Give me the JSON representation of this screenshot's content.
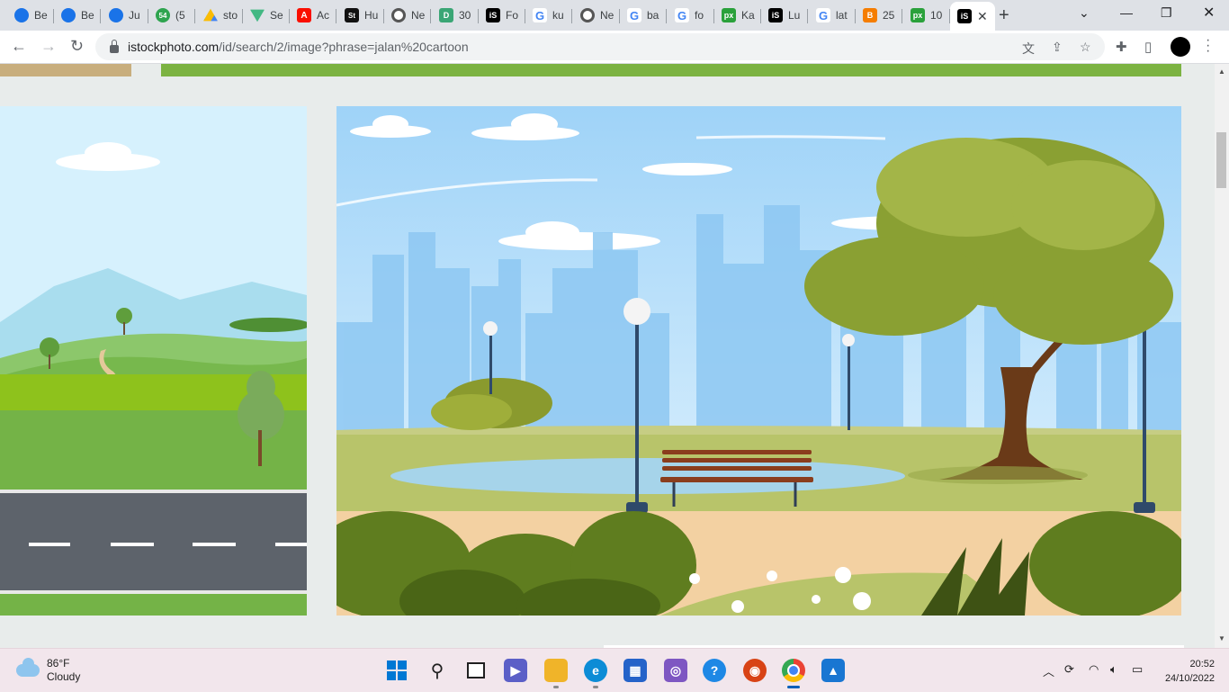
{
  "tabs": [
    {
      "label": "Be",
      "icon": "c"
    },
    {
      "label": "Be",
      "icon": "c"
    },
    {
      "label": "Ju",
      "icon": "c"
    },
    {
      "label": "(5",
      "icon": "n54",
      "icon_text": "54"
    },
    {
      "label": "sto",
      "icon": "drive"
    },
    {
      "label": "Se",
      "icon": "vue"
    },
    {
      "label": "Ac",
      "icon": "adobe",
      "icon_text": "A"
    },
    {
      "label": "Hu",
      "icon": "st",
      "icon_text": "St"
    },
    {
      "label": "Ne",
      "icon": "gh"
    },
    {
      "label": "30",
      "icon": "d",
      "icon_text": "D"
    },
    {
      "label": "Fo",
      "icon": "is",
      "icon_text": "iS"
    },
    {
      "label": "ku",
      "icon": "g",
      "icon_text": "G"
    },
    {
      "label": "Ne",
      "icon": "gh"
    },
    {
      "label": "ba",
      "icon": "g",
      "icon_text": "G"
    },
    {
      "label": "fo",
      "icon": "g",
      "icon_text": "G"
    },
    {
      "label": "Ka",
      "icon": "px",
      "icon_text": "px"
    },
    {
      "label": "Lu",
      "icon": "is",
      "icon_text": "iS"
    },
    {
      "label": "lat",
      "icon": "g",
      "icon_text": "G"
    },
    {
      "label": "25",
      "icon": "blog",
      "icon_text": "B"
    },
    {
      "label": "10",
      "icon": "px",
      "icon_text": "px"
    },
    {
      "label": "",
      "icon": "is",
      "icon_text": "iS",
      "active": true
    }
  ],
  "address": {
    "host": "istockphoto.com",
    "path": "/id/search/2/image?phrase=jalan%20cartoon"
  },
  "taskbar": {
    "temperature": "86°F",
    "condition": "Cloudy",
    "time": "20:52",
    "date": "24/10/2022"
  },
  "colors": {
    "tabstrip": "#dee1e6",
    "page_bg": "#e8eceb",
    "taskbar": "#f2e6ec",
    "grass_strip": "#7cb342",
    "sand_strip": "#c8ae7d"
  }
}
